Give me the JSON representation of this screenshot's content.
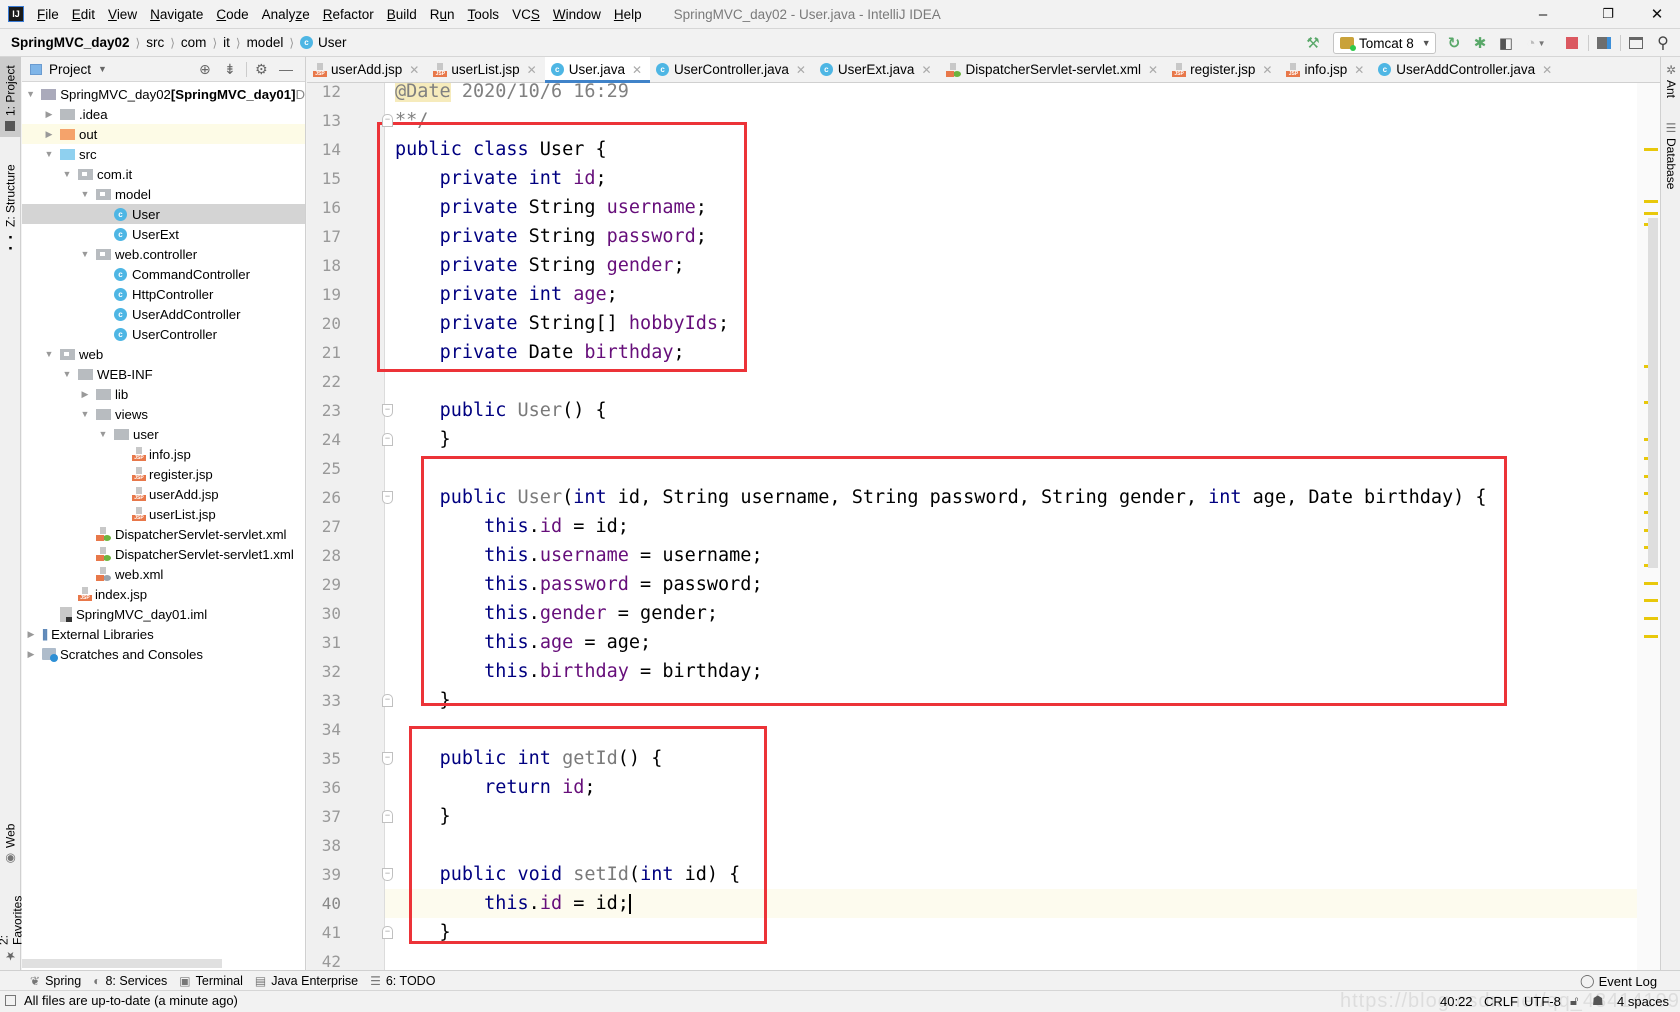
{
  "menubar": {
    "items": [
      "File",
      "Edit",
      "View",
      "Navigate",
      "Code",
      "Analyze",
      "Refactor",
      "Build",
      "Run",
      "Tools",
      "VCS",
      "Window",
      "Help"
    ],
    "mnemonics": [
      "F",
      "E",
      "V",
      "N",
      "C",
      "z",
      "R",
      "B",
      "u",
      "T",
      "S",
      "W",
      "H"
    ],
    "window_title": "SpringMVC_day02 - User.java - IntelliJ IDEA",
    "logo": "IJ",
    "minimize": "–",
    "maximize": "❐",
    "close": "✕"
  },
  "breadcrumb": {
    "items": [
      "SpringMVC_day02",
      "src",
      "com",
      "it",
      "model",
      "User"
    ],
    "sep": "⟩"
  },
  "toolbar": {
    "run_config": "Tomcat 8",
    "build_icon": "hammer-icon",
    "rerun_icon": "rerun-icon",
    "debug_icon": "bug-icon",
    "coverage_icon": "coverage-icon",
    "profile_icon": "profile-icon",
    "stop_icon": "stop-icon",
    "project_structure_icon": "project-structure-icon",
    "terminal_icon": "terminal-icon",
    "search_icon": "search-icon",
    "colors": {
      "green": "#59a869",
      "stop": "#db5860"
    }
  },
  "left_strip": {
    "tabs": [
      "1: Project",
      "Z: Structure",
      "Web",
      "2: Favorites"
    ]
  },
  "right_strip": {
    "tabs": [
      "Ant",
      "Database"
    ]
  },
  "project_panel": {
    "title": "Project",
    "tree": [
      {
        "label": "SpringMVC_day02",
        "suffix": "[SpringMVC_day01]",
        "tail": "D",
        "type": "module",
        "depth": 0,
        "arrow": "down"
      },
      {
        "label": ".idea",
        "type": "folder",
        "depth": 1,
        "arrow": "right"
      },
      {
        "label": "out",
        "type": "folder-out",
        "depth": 1,
        "arrow": "right",
        "highlight": true
      },
      {
        "label": "src",
        "type": "folder-src",
        "depth": 1,
        "arrow": "down"
      },
      {
        "label": "com.it",
        "type": "package",
        "depth": 2,
        "arrow": "down"
      },
      {
        "label": "model",
        "type": "package",
        "depth": 3,
        "arrow": "down"
      },
      {
        "label": "User",
        "type": "class",
        "depth": 4,
        "selected": true
      },
      {
        "label": "UserExt",
        "type": "class",
        "depth": 4
      },
      {
        "label": "web.controller",
        "type": "package",
        "depth": 3,
        "arrow": "down"
      },
      {
        "label": "CommandController",
        "type": "class",
        "depth": 4
      },
      {
        "label": "HttpController",
        "type": "class",
        "depth": 4
      },
      {
        "label": "UserAddController",
        "type": "class",
        "depth": 4
      },
      {
        "label": "UserController",
        "type": "class",
        "depth": 4
      },
      {
        "label": "web",
        "type": "package",
        "depth": 1,
        "arrow": "down"
      },
      {
        "label": "WEB-INF",
        "type": "folder",
        "depth": 2,
        "arrow": "down"
      },
      {
        "label": "lib",
        "type": "folder",
        "depth": 3,
        "arrow": "right"
      },
      {
        "label": "views",
        "type": "folder",
        "depth": 3,
        "arrow": "down"
      },
      {
        "label": "user",
        "type": "folder",
        "depth": 4,
        "arrow": "down"
      },
      {
        "label": "info.jsp",
        "type": "jsp",
        "depth": 5
      },
      {
        "label": "register.jsp",
        "type": "jsp",
        "depth": 5
      },
      {
        "label": "userAdd.jsp",
        "type": "jsp",
        "depth": 5
      },
      {
        "label": "userList.jsp",
        "type": "jsp",
        "depth": 5
      },
      {
        "label": "DispatcherServlet-servlet.xml",
        "type": "xml",
        "depth": 3
      },
      {
        "label": "DispatcherServlet-servlet1.xml",
        "type": "xml",
        "depth": 3
      },
      {
        "label": "web.xml",
        "type": "webxml",
        "depth": 3
      },
      {
        "label": "index.jsp",
        "type": "jsp",
        "depth": 2
      },
      {
        "label": "SpringMVC_day01.iml",
        "type": "iml",
        "depth": 1
      },
      {
        "label": "External Libraries",
        "type": "libs",
        "depth": 0,
        "arrow": "right"
      },
      {
        "label": "Scratches and Consoles",
        "type": "scratch",
        "depth": 0,
        "arrow": "right"
      }
    ]
  },
  "editor_tabs": [
    {
      "label": "userAdd.jsp",
      "type": "jsp"
    },
    {
      "label": "userList.jsp",
      "type": "jsp"
    },
    {
      "label": "User.java",
      "type": "class",
      "active": true
    },
    {
      "label": "UserController.java",
      "type": "class"
    },
    {
      "label": "UserExt.java",
      "type": "class"
    },
    {
      "label": "DispatcherServlet-servlet.xml",
      "type": "xml"
    },
    {
      "label": "register.jsp",
      "type": "jsp"
    },
    {
      "label": "info.jsp",
      "type": "jsp"
    },
    {
      "label": "UserAddController.java",
      "type": "class"
    }
  ],
  "editor": {
    "first_line": 12,
    "caret_line": 40,
    "cursor_position": "40:22",
    "lines": [
      [
        [
          "anno",
          "@Date"
        ],
        [
          "cm",
          " 2020/10/6 16:29"
        ]
      ],
      [
        [
          "cm",
          "**/"
        ]
      ],
      [
        [
          "kw",
          "public class "
        ],
        [
          "",
          "User {"
        ]
      ],
      [
        [
          "",
          "    "
        ],
        [
          "kw",
          "private int "
        ],
        [
          "fld",
          "id"
        ],
        [
          "",
          ";"
        ]
      ],
      [
        [
          "",
          "    "
        ],
        [
          "kw",
          "private "
        ],
        [
          "",
          "String "
        ],
        [
          "fld",
          "username"
        ],
        [
          "",
          ";"
        ]
      ],
      [
        [
          "",
          "    "
        ],
        [
          "kw",
          "private "
        ],
        [
          "",
          "String "
        ],
        [
          "fld",
          "password"
        ],
        [
          "",
          ";"
        ]
      ],
      [
        [
          "",
          "    "
        ],
        [
          "kw",
          "private "
        ],
        [
          "",
          "String "
        ],
        [
          "fld",
          "gender"
        ],
        [
          "",
          ";"
        ]
      ],
      [
        [
          "",
          "    "
        ],
        [
          "kw",
          "private int "
        ],
        [
          "fld",
          "age"
        ],
        [
          "",
          ";"
        ]
      ],
      [
        [
          "",
          "    "
        ],
        [
          "kw",
          "private "
        ],
        [
          "",
          "String[] "
        ],
        [
          "fld",
          "hobbyIds"
        ],
        [
          "",
          ";"
        ]
      ],
      [
        [
          "",
          "    "
        ],
        [
          "kw",
          "private "
        ],
        [
          "",
          "Date "
        ],
        [
          "fld",
          "birthday"
        ],
        [
          "",
          ";"
        ]
      ],
      [],
      [
        [
          "",
          "    "
        ],
        [
          "kw",
          "public "
        ],
        [
          "fn",
          "User"
        ],
        [
          "",
          "() {"
        ]
      ],
      [
        [
          "",
          "    }"
        ]
      ],
      [],
      [
        [
          "",
          "    "
        ],
        [
          "kw",
          "public "
        ],
        [
          "fn",
          "User"
        ],
        [
          "",
          "("
        ],
        [
          "kw",
          "int "
        ],
        [
          "",
          "id, String username, String password, String gender, "
        ],
        [
          "kw",
          "int "
        ],
        [
          "",
          "age, Date birthday) {"
        ]
      ],
      [
        [
          "",
          "        "
        ],
        [
          "kw",
          "this"
        ],
        [
          "",
          "."
        ],
        [
          "fld",
          "id"
        ],
        [
          "",
          " = id;"
        ]
      ],
      [
        [
          "",
          "        "
        ],
        [
          "kw",
          "this"
        ],
        [
          "",
          "."
        ],
        [
          "fld",
          "username"
        ],
        [
          "",
          " = username;"
        ]
      ],
      [
        [
          "",
          "        "
        ],
        [
          "kw",
          "this"
        ],
        [
          "",
          "."
        ],
        [
          "fld",
          "password"
        ],
        [
          "",
          " = password;"
        ]
      ],
      [
        [
          "",
          "        "
        ],
        [
          "kw",
          "this"
        ],
        [
          "",
          "."
        ],
        [
          "fld",
          "gender"
        ],
        [
          "",
          " = gender;"
        ]
      ],
      [
        [
          "",
          "        "
        ],
        [
          "kw",
          "this"
        ],
        [
          "",
          "."
        ],
        [
          "fld",
          "age"
        ],
        [
          "",
          " = age;"
        ]
      ],
      [
        [
          "",
          "        "
        ],
        [
          "kw",
          "this"
        ],
        [
          "",
          "."
        ],
        [
          "fld",
          "birthday"
        ],
        [
          "",
          " = birthday;"
        ]
      ],
      [
        [
          "",
          "    }"
        ]
      ],
      [],
      [
        [
          "",
          "    "
        ],
        [
          "kw",
          "public int "
        ],
        [
          "fn",
          "getId"
        ],
        [
          "",
          "() {"
        ]
      ],
      [
        [
          "",
          "        "
        ],
        [
          "kw",
          "return "
        ],
        [
          "fld",
          "id"
        ],
        [
          "",
          ";"
        ]
      ],
      [
        [
          "",
          "    }"
        ]
      ],
      [],
      [
        [
          "",
          "    "
        ],
        [
          "kw",
          "public void "
        ],
        [
          "fn",
          "setId"
        ],
        [
          "",
          "("
        ],
        [
          "kw",
          "int "
        ],
        [
          "",
          "id) {"
        ]
      ],
      [
        [
          "",
          "        "
        ],
        [
          "kw",
          "this"
        ],
        [
          "",
          "."
        ],
        [
          "fld",
          "id"
        ],
        [
          "",
          " = id;"
        ],
        [
          "caret",
          ""
        ]
      ],
      [
        [
          "",
          "    }"
        ]
      ],
      []
    ],
    "fold_open_lines": [
      23,
      26,
      35,
      39
    ],
    "fold_close_lines": [
      13,
      24,
      33,
      37,
      41
    ],
    "highlight_color": "#ec3338"
  },
  "tool_windows": [
    {
      "label": "Spring",
      "icon": "spring-icon"
    },
    {
      "label": "8: Services",
      "icon": "services-icon"
    },
    {
      "label": "Terminal",
      "icon": "terminal-icon"
    },
    {
      "label": "Java Enterprise",
      "icon": "java-enterprise-icon"
    },
    {
      "label": "6: TODO",
      "icon": "todo-icon"
    }
  ],
  "event_log": "Event Log",
  "status": {
    "message": "All files are up-to-date (a minute ago)",
    "position": "40:22",
    "line_sep": "CRLF",
    "encoding": "UTF-8",
    "indent": "4 spaces",
    "watermark": "https://blog.csdn.net/qq_43414199"
  }
}
